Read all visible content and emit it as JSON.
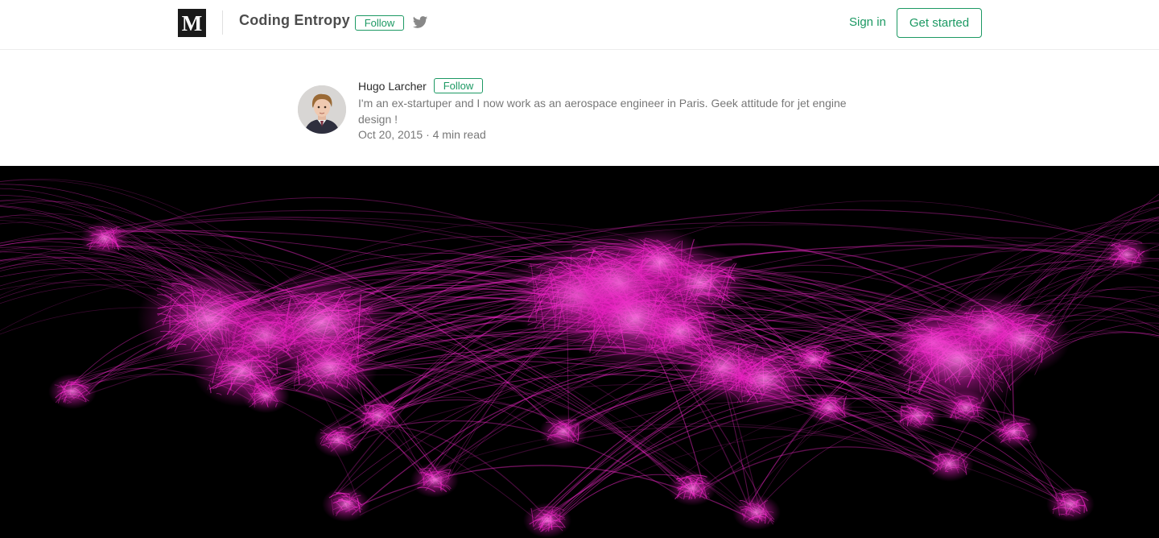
{
  "header": {
    "publication_name": "Coding Entropy",
    "publication_follow_label": "Follow",
    "logo_letter": "M",
    "sign_in_label": "Sign in",
    "get_started_label": "Get started",
    "twitter_icon": "twitter-icon"
  },
  "author": {
    "name": "Hugo Larcher",
    "follow_label": "Follow",
    "bio": "I'm an ex-startuper and I now work as an aerospace engineer in Paris. Geek attitude for jet engine design !",
    "date": "Oct 20, 2015",
    "read_time": "4 min read",
    "separator": "·"
  },
  "colors": {
    "accent": "#1c9963",
    "hero_background": "#000000",
    "route_color": "#ff2ad4"
  },
  "hero": {
    "icon": "world-flight-routes-image"
  }
}
